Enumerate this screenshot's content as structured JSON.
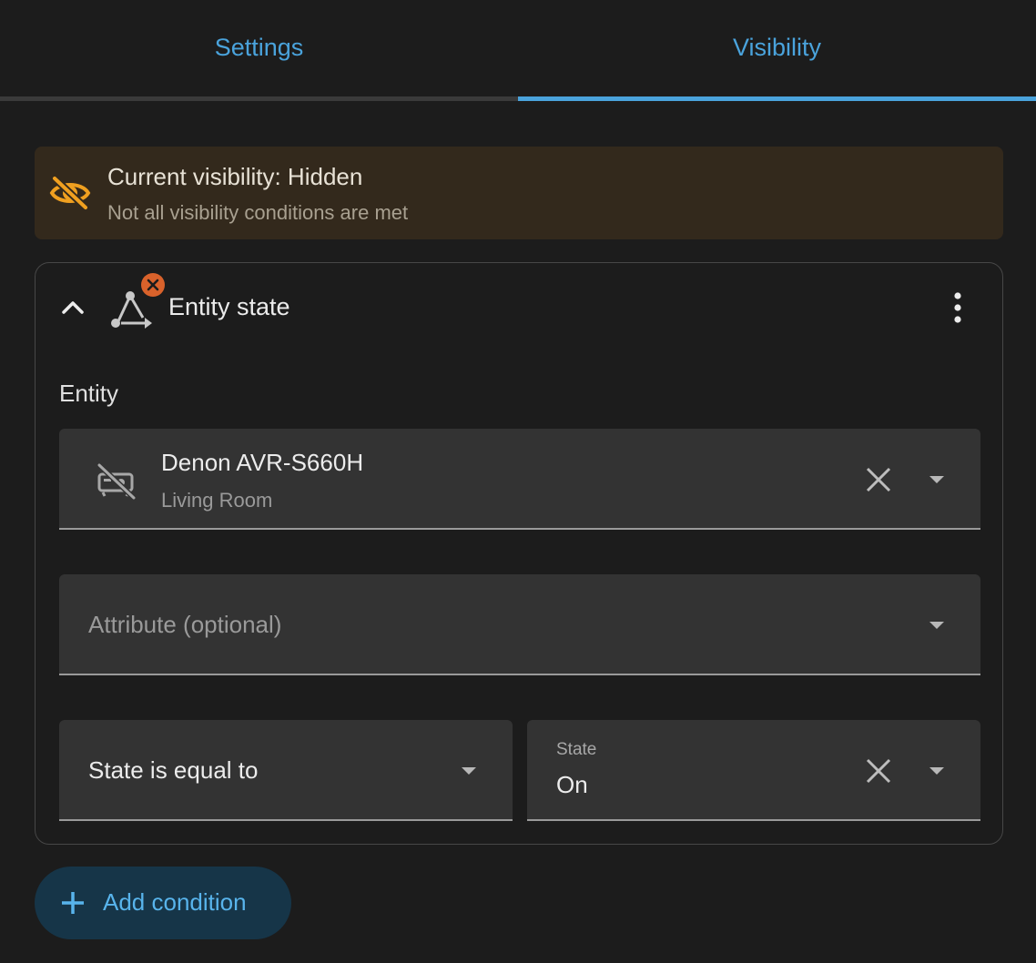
{
  "tabs": [
    {
      "label": "Settings",
      "active": false
    },
    {
      "label": "Visibility",
      "active": true
    }
  ],
  "banner": {
    "title": "Current visibility: Hidden",
    "subtitle": "Not all visibility conditions are met",
    "icon": "eye-off-icon",
    "color": "#f0a020"
  },
  "condition": {
    "title": "Entity state",
    "icon": "state-machine-icon",
    "badge_icon": "error-x-icon",
    "entity": {
      "label": "Entity",
      "name": "Denon AVR-S660H",
      "area": "Living Room",
      "icon": "speaker-off-icon"
    },
    "attribute": {
      "placeholder": "Attribute (optional)"
    },
    "comparison": {
      "value": "State is equal to"
    },
    "state": {
      "label": "State",
      "value": "On"
    }
  },
  "add_button": {
    "label": "Add condition"
  },
  "colors": {
    "accent": "#4aa3dc",
    "warning_bg": "#33291c",
    "error": "#d9622b",
    "background": "#1c1c1c"
  }
}
